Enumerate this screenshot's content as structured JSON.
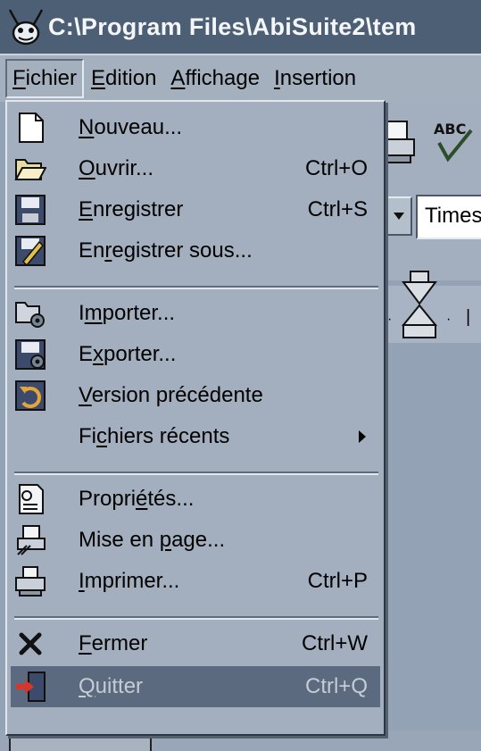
{
  "window": {
    "title": "C:\\Program Files\\AbiSuite2\\tem"
  },
  "menubar": {
    "items": [
      {
        "pre": "",
        "ul": "F",
        "post": "ichier"
      },
      {
        "pre": "",
        "ul": "E",
        "post": "dition"
      },
      {
        "pre": "",
        "ul": "A",
        "post": "ffichage"
      },
      {
        "pre": "",
        "ul": "I",
        "post": "nsertion"
      }
    ]
  },
  "toolbar": {
    "spell_icon_text": "ABC",
    "font_name": "Times"
  },
  "file_menu": {
    "new": {
      "pre": "",
      "ul": "N",
      "post": "ouveau...",
      "shortcut": ""
    },
    "open": {
      "pre": "",
      "ul": "O",
      "post": "uvrir...",
      "shortcut": "Ctrl+O"
    },
    "save": {
      "pre": "",
      "ul": "E",
      "post": "nregistrer",
      "shortcut": "Ctrl+S"
    },
    "save_as": {
      "pre": "En",
      "ul": "r",
      "post": "egistrer sous...",
      "shortcut": ""
    },
    "import": {
      "pre": "I",
      "ul": "m",
      "post": "porter...",
      "shortcut": ""
    },
    "export": {
      "pre": "E",
      "ul": "x",
      "post": "porter...",
      "shortcut": ""
    },
    "revert": {
      "pre": "",
      "ul": "V",
      "post": "ersion précédente",
      "shortcut": ""
    },
    "recent": {
      "pre": "Fi",
      "ul": "c",
      "post": "hiers récents",
      "shortcut": ""
    },
    "properties": {
      "pre": "Propri",
      "ul": "é",
      "post": "tés...",
      "shortcut": ""
    },
    "page_setup": {
      "pre": "Mise en ",
      "ul": "p",
      "post": "age...",
      "shortcut": ""
    },
    "print": {
      "pre": "",
      "ul": "I",
      "post": "mprimer...",
      "shortcut": "Ctrl+P"
    },
    "close": {
      "pre": "",
      "ul": "F",
      "post": "ermer",
      "shortcut": "Ctrl+W"
    },
    "quit": {
      "pre": "",
      "ul": "Q",
      "post": "uitter",
      "shortcut": "Ctrl+Q"
    }
  },
  "colors": {
    "titlebar": "#4d5f74",
    "menu_bg": "#a3afbe",
    "selection": "#5b6a7e"
  },
  "icons": {
    "app": "abiword-ant-icon",
    "new": "new-document-icon",
    "open": "open-folder-icon",
    "save": "save-disk-icon",
    "save_as": "save-as-icon",
    "import": "import-icon",
    "export": "export-icon",
    "revert": "revert-icon",
    "properties": "properties-icon",
    "page_setup": "page-setup-icon",
    "print": "print-icon",
    "close": "close-x-icon",
    "quit": "exit-door-icon"
  }
}
